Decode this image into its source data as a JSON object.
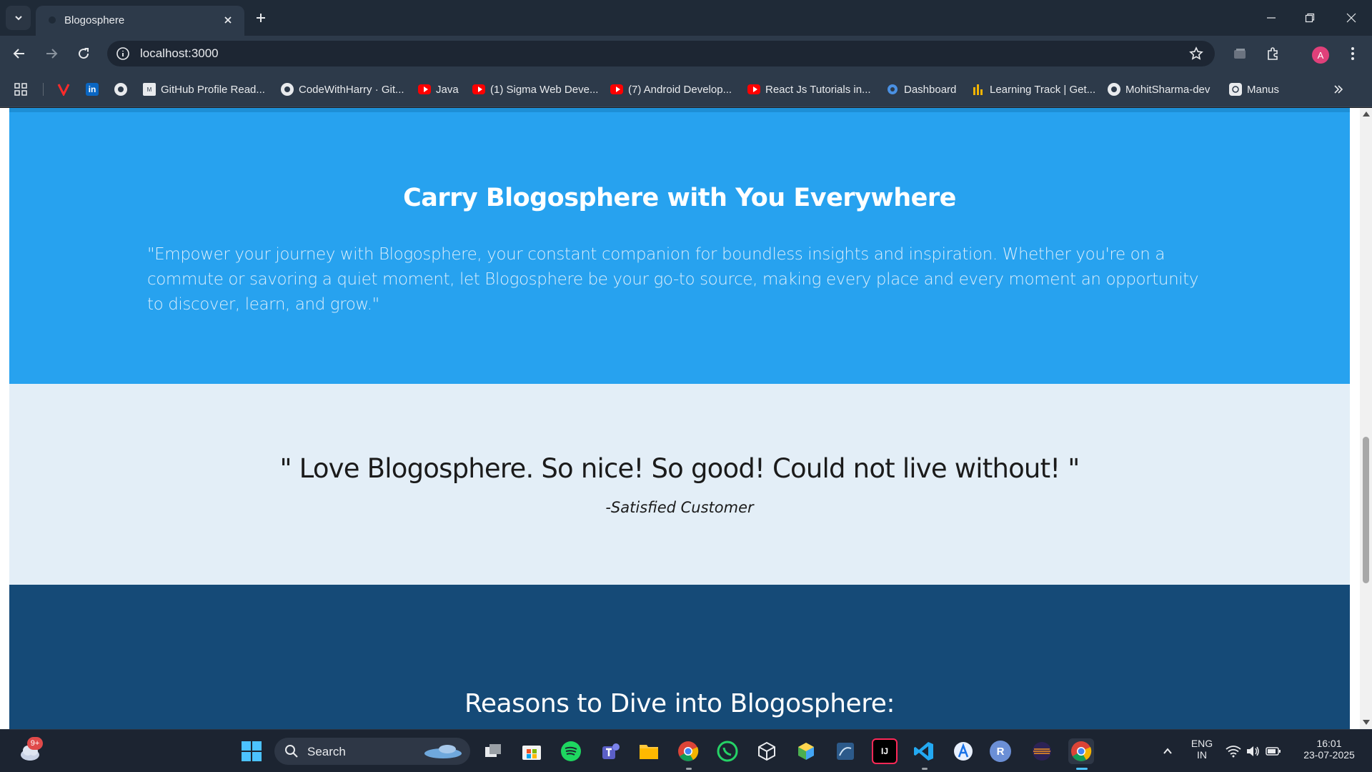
{
  "browser": {
    "tab_title": "Blogosphere",
    "url": "localhost:3000",
    "profile_initial": "A"
  },
  "bookmarks": [
    {
      "label": "",
      "icon": "apps-grid-icon"
    },
    {
      "label": "",
      "icon": "vectr-icon"
    },
    {
      "label": "",
      "icon": "linkedin-icon"
    },
    {
      "label": "",
      "icon": "github-icon"
    },
    {
      "label": "GitHub Profile Read...",
      "icon": "github-readme-icon"
    },
    {
      "label": "CodeWithHarry · Git...",
      "icon": "github-icon"
    },
    {
      "label": "Java",
      "icon": "youtube-icon"
    },
    {
      "label": "(1) Sigma Web Deve...",
      "icon": "youtube-icon"
    },
    {
      "label": "(7) Android Develop...",
      "icon": "youtube-icon"
    },
    {
      "label": "React Js Tutorials in...",
      "icon": "youtube-icon"
    },
    {
      "label": "Dashboard",
      "icon": "dashboard-icon"
    },
    {
      "label": "Learning Track | Get...",
      "icon": "learning-track-icon"
    },
    {
      "label": "MohitSharma-dev",
      "icon": "github-icon"
    },
    {
      "label": "Manus",
      "icon": "manus-icon"
    }
  ],
  "page": {
    "hero": {
      "heading": "Carry Blogosphere with You Everywhere",
      "text": "\"Empower your journey with Blogosphere, your constant companion for boundless insights and inspiration. Whether you're on a commute or savoring a quiet moment, let Blogosphere be your go-to source, making every place and every moment an opportunity to discover, learn, and grow.\""
    },
    "testimonial": {
      "quote": "\" Love Blogosphere. So nice! So good! Could not live without! \"",
      "author": "-Satisfied Customer"
    },
    "reasons": {
      "heading": "Reasons to Dive into Blogosphere:"
    }
  },
  "taskbar": {
    "search_label": "Search",
    "weather_badge": "9+",
    "language": "ENG",
    "region": "IN",
    "time": "16:01",
    "date": "23-07-2025"
  },
  "colors": {
    "hero_bg": "#27a2ef",
    "testimonial_bg": "#e3eef7",
    "reasons_bg": "#154a77"
  }
}
